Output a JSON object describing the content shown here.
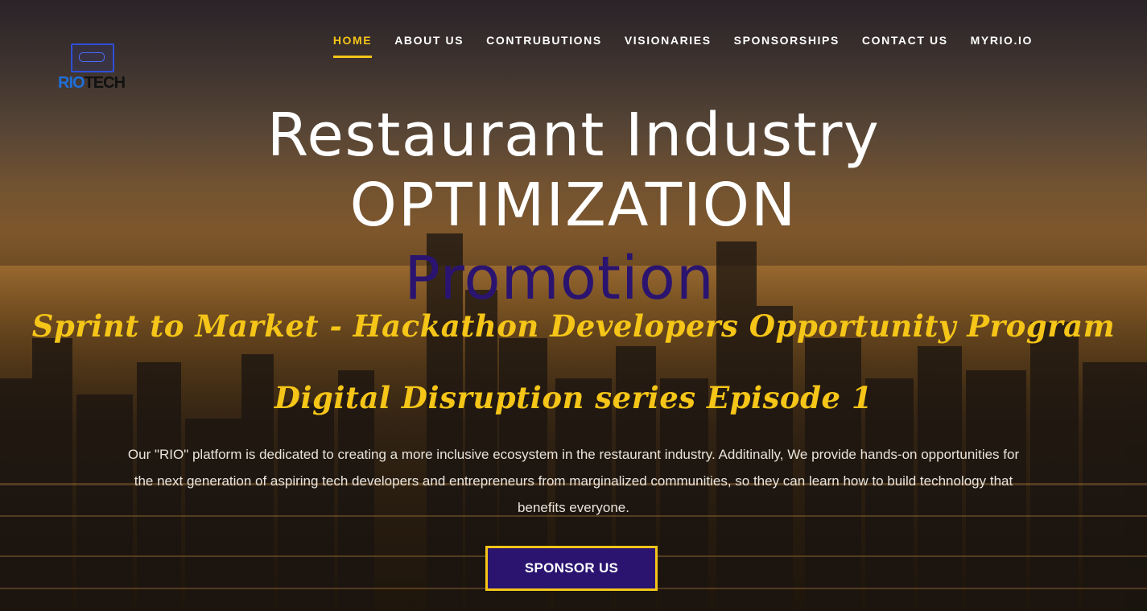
{
  "logo": {
    "brand_left": "RIO",
    "brand_right": "TECH",
    "icon": "laptop-icon"
  },
  "nav": {
    "items": [
      {
        "label": "HOME",
        "active": true
      },
      {
        "label": "ABOUT US"
      },
      {
        "label": "CONTRUBUTIONS"
      },
      {
        "label": "VISIONARIES"
      },
      {
        "label": "SPONSORSHIPS"
      },
      {
        "label": "CONTACT US"
      },
      {
        "label": "MYRIO.IO"
      }
    ]
  },
  "hero": {
    "line1": "Restaurant Industry",
    "line2": "OPTIMIZATION",
    "line3": "Promotion",
    "tagline1": "Sprint to Market - Hackathon Developers Opportunity Program",
    "tagline2": "Digital Disruption series Episode 1",
    "description": "Our \"RIO\" platform is dedicated to creating a more inclusive ecosystem in the restaurant industry. Additinally, We provide hands-on opportunities for the next generation of aspiring tech developers and entrepreneurs from marginalized communities, so they can learn how to build technology that benefits everyone.",
    "cta": "SPONSOR US"
  },
  "colors": {
    "accent": "#f5c518",
    "primary": "#2a1470"
  }
}
